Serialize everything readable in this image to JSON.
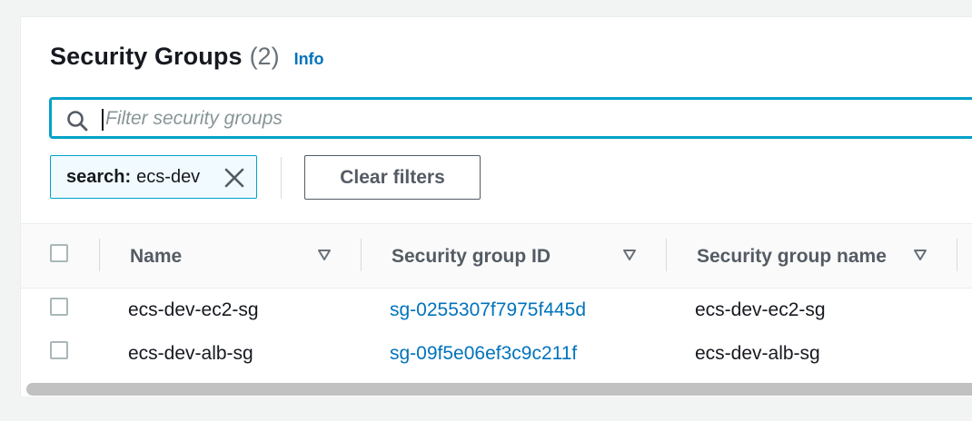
{
  "header": {
    "title": "Security Groups",
    "count": "(2)",
    "info_label": "Info"
  },
  "search": {
    "placeholder": "Filter security groups",
    "value": "",
    "icon": "search-icon"
  },
  "filter_token": {
    "key": "search:",
    "value": "ecs-dev",
    "icon": "close-icon"
  },
  "clear_filters_label": "Clear filters",
  "table": {
    "columns": [
      "Name",
      "Security group ID",
      "Security group name"
    ],
    "rows": [
      {
        "name": "ecs-dev-ec2-sg",
        "group_id": "sg-0255307f7975f445d",
        "group_name": "ecs-dev-ec2-sg"
      },
      {
        "name": "ecs-dev-alb-sg",
        "group_id": "sg-09f5e06ef3c9c211f",
        "group_name": "ecs-dev-alb-sg"
      }
    ]
  },
  "colors": {
    "link": "#0073bb",
    "focus": "#00a1c9",
    "token_bg": "#f1faff",
    "page_bg": "#f2f3f3"
  }
}
